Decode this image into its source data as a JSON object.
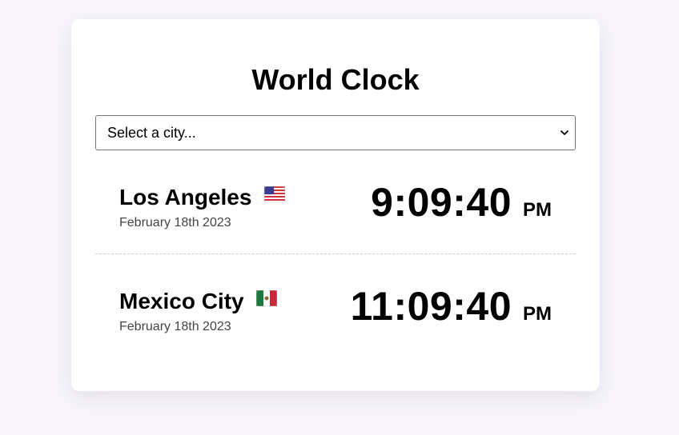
{
  "header": {
    "title": "World Clock"
  },
  "city_select": {
    "selected": "Select a city..."
  },
  "clocks": [
    {
      "city": "Los Angeles",
      "flag": "us-flag-icon",
      "date": "February 18th 2023",
      "time": "9:09:40",
      "period": "PM"
    },
    {
      "city": "Mexico City",
      "flag": "mexico-flag-icon",
      "date": "February 18th 2023",
      "time": "11:09:40",
      "period": "PM"
    }
  ],
  "colors": {
    "page_background": "#f8f5fc",
    "card_background": "#ffffff",
    "divider": "#cfcfcf"
  }
}
